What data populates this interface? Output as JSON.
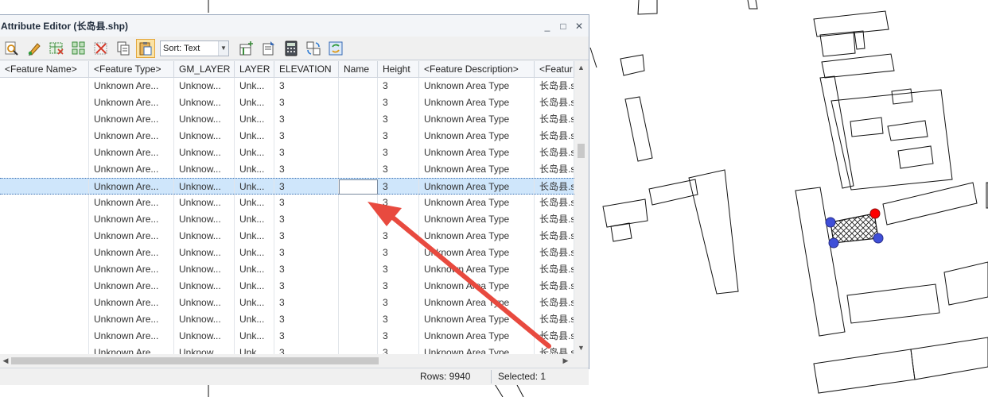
{
  "window": {
    "title": "Attribute Editor (长岛县.shp)",
    "controls": [
      "_",
      "□",
      "✕"
    ]
  },
  "toolbar": {
    "sort_label": "Sort: Text"
  },
  "table": {
    "columns": [
      "<Feature Name>",
      "<Feature Type>",
      "GM_LAYER",
      "LAYER",
      "ELEVATION",
      "Name",
      "Height",
      "<Feature Description>",
      "<Featur"
    ],
    "rows": [
      [
        "",
        "Unknown Are...",
        "Unknow...",
        "Unk...",
        "3",
        "",
        "3",
        "Unknown Area Type",
        "长岛县.s"
      ],
      [
        "",
        "Unknown Are...",
        "Unknow...",
        "Unk...",
        "3",
        "",
        "3",
        "Unknown Area Type",
        "长岛县.s"
      ],
      [
        "",
        "Unknown Are...",
        "Unknow...",
        "Unk...",
        "3",
        "",
        "3",
        "Unknown Area Type",
        "长岛县.s"
      ],
      [
        "",
        "Unknown Are...",
        "Unknow...",
        "Unk...",
        "3",
        "",
        "3",
        "Unknown Area Type",
        "长岛县.s"
      ],
      [
        "",
        "Unknown Are...",
        "Unknow...",
        "Unk...",
        "3",
        "",
        "3",
        "Unknown Area Type",
        "长岛县.s"
      ],
      [
        "",
        "Unknown Are...",
        "Unknow...",
        "Unk...",
        "3",
        "",
        "3",
        "Unknown Area Type",
        "长岛县.s"
      ],
      [
        "",
        "Unknown Are...",
        "Unknow...",
        "Unk...",
        "3",
        "",
        "3",
        "Unknown Area Type",
        "长岛县.s"
      ],
      [
        "",
        "Unknown Are...",
        "Unknow...",
        "Unk...",
        "3",
        "",
        "3",
        "Unknown Area Type",
        "长岛县.s"
      ],
      [
        "",
        "Unknown Are...",
        "Unknow...",
        "Unk...",
        "3",
        "",
        "3",
        "Unknown Area Type",
        "长岛县.s"
      ],
      [
        "",
        "Unknown Are...",
        "Unknow...",
        "Unk...",
        "3",
        "",
        "3",
        "Unknown Area Type",
        "长岛县.s"
      ],
      [
        "",
        "Unknown Are...",
        "Unknow...",
        "Unk...",
        "3",
        "",
        "3",
        "Unknown Area Type",
        "长岛县.s"
      ],
      [
        "",
        "Unknown Are...",
        "Unknow...",
        "Unk...",
        "3",
        "",
        "3",
        "Unknown Area Type",
        "长岛县.s"
      ],
      [
        "",
        "Unknown Are...",
        "Unknow...",
        "Unk...",
        "3",
        "",
        "3",
        "Unknown Area Type",
        "长岛县.s"
      ],
      [
        "",
        "Unknown Are...",
        "Unknow...",
        "Unk...",
        "3",
        "",
        "3",
        "Unknown Area Type",
        "长岛县.s"
      ],
      [
        "",
        "Unknown Are...",
        "Unknow...",
        "Unk...",
        "3",
        "",
        "3",
        "Unknown Area Type",
        "长岛县.s"
      ],
      [
        "",
        "Unknown Are...",
        "Unknow...",
        "Unk...",
        "3",
        "",
        "3",
        "Unknown Area Type",
        "长岛县.s"
      ],
      [
        "",
        "Unknown Are...",
        "Unknow...",
        "Unk...",
        "3",
        "",
        "3",
        "Unknown Area Type",
        "长岛县.s"
      ],
      [
        "",
        "Unknown Are...",
        "Unknow...",
        "Unk...",
        "3",
        "",
        "3",
        "Unknown Area Type",
        "长岛县.s"
      ],
      [
        "",
        "Unknown Are...",
        "Unknow...",
        "Unk...",
        "3",
        "",
        "3",
        "Unknown Area Type",
        "长岛县.s"
      ]
    ],
    "selected_row_index": 6,
    "editing_column": "Name"
  },
  "status": {
    "rows": "Rows: 9940",
    "selected": "Selected: 1"
  },
  "colors": {
    "selection": "#cfe6fb",
    "arrow": "#e84a3f",
    "vertex_blue": "#3f4fd8",
    "vertex_red": "#ff0000"
  },
  "icons": [
    "search-zoom-icon",
    "pencil-edit-icon",
    "select-table-icon",
    "select-grid-icon",
    "delete-x-icon",
    "copy-icon",
    "paste-icon",
    "new-column-icon",
    "calculate-icon",
    "calculator-icon",
    "sync-icon",
    "refresh-icon"
  ]
}
